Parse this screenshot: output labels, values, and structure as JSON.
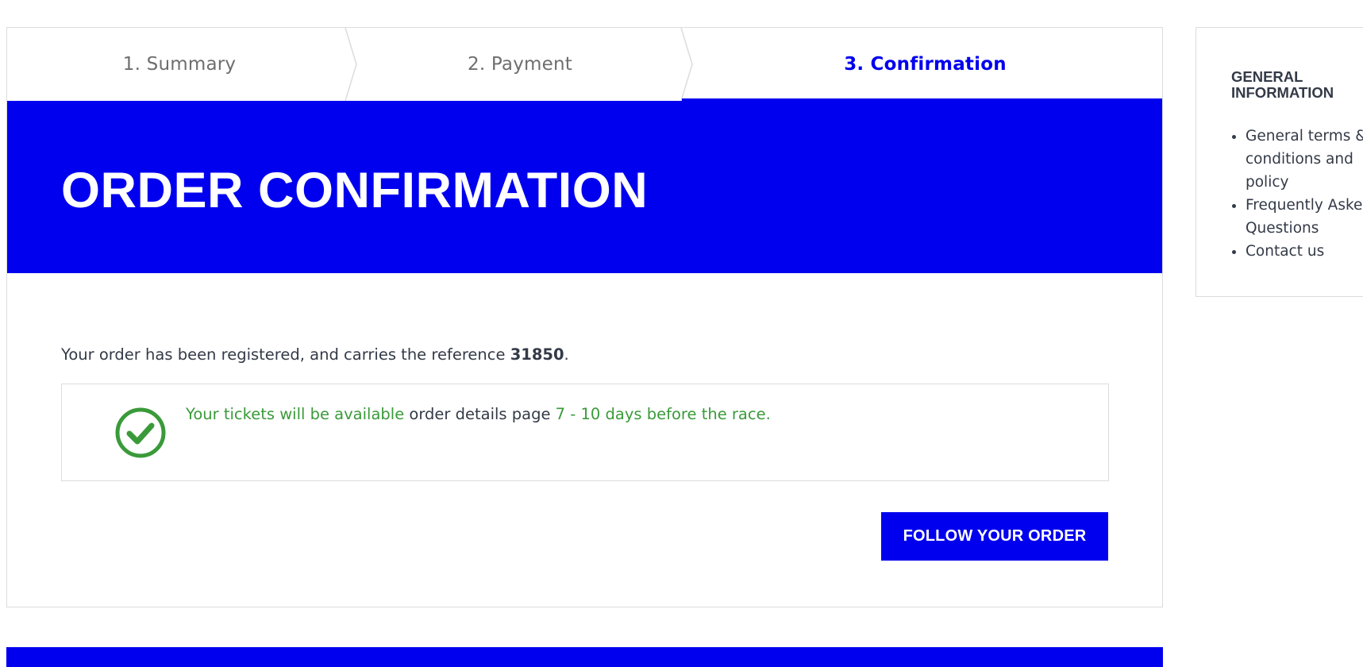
{
  "steps": [
    {
      "label": "1. Summary",
      "active": false
    },
    {
      "label": "2. Payment",
      "active": false
    },
    {
      "label": "3. Confirmation",
      "active": true
    }
  ],
  "banner": {
    "title": "ORDER CONFIRMATION"
  },
  "order": {
    "message_prefix": "Your order has been registered, and carries the reference ",
    "reference": "31850",
    "message_suffix": "."
  },
  "notice": {
    "icon": "check-circle-icon",
    "part1": "Your tickets will be available",
    "part2": " order details page ",
    "part3": "7 - 10 days before the race."
  },
  "follow_button": {
    "label": "FOLLOW YOUR ORDER"
  },
  "sidebar": {
    "title": "GENERAL INFORMATION",
    "links": [
      {
        "label": "General terms & conditions and policy"
      },
      {
        "label": "Frequently Asked Questions"
      },
      {
        "label": "Contact us"
      }
    ]
  },
  "colors": {
    "accent": "#0000ee",
    "success": "#3a9a3a",
    "text": "#333a47",
    "muted": "#6e6e6e",
    "border": "#dcdcdc"
  }
}
